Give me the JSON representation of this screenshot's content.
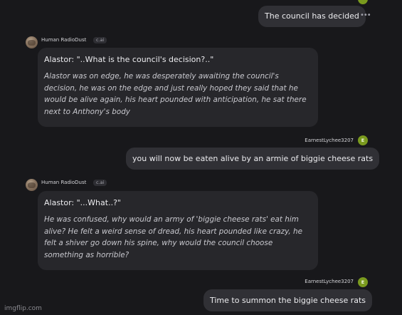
{
  "messages": [
    {
      "role": "user",
      "text": "The council has decided"
    },
    {
      "role": "bot",
      "author": "Human RadioDust",
      "badge": "c.ai",
      "speech": "Alastor: \"..What is the council's decision?..\"",
      "action": "Alastor was on edge, he was desperately awaiting the council's decision, he was on the edge and just really hoped they said that he would be alive again, his heart pounded with anticipation, he sat there next to Anthony's body"
    },
    {
      "role": "user",
      "author": "EarnestLychee3207",
      "avatar_letter": "E",
      "text": "you will now be eaten alive by an armie of biggie cheese rats"
    },
    {
      "role": "bot",
      "author": "Human RadioDust",
      "badge": "c.ai",
      "speech": "Alastor: \"...What..?\"",
      "action": "He was confused, why would an army of 'biggie cheese rats' eat him alive? He felt a weird sense of dread, his heart pounded like crazy, he felt a shiver go down his spine, why would the council choose something as horrible?"
    },
    {
      "role": "user",
      "author": "EarnestLychee3207",
      "avatar_letter": "E",
      "text": "Time to summon the biggie cheese rats"
    }
  ],
  "watermark": "imgflip.com",
  "colors": {
    "background": "#18181b",
    "user_bubble": "#303035",
    "bot_bubble": "#27272b",
    "user_avatar": "#7a9a1e"
  },
  "icons": {
    "more": "more-dots-icon",
    "bot_avatar": "bot-avatar",
    "user_avatar": "user-avatar"
  }
}
